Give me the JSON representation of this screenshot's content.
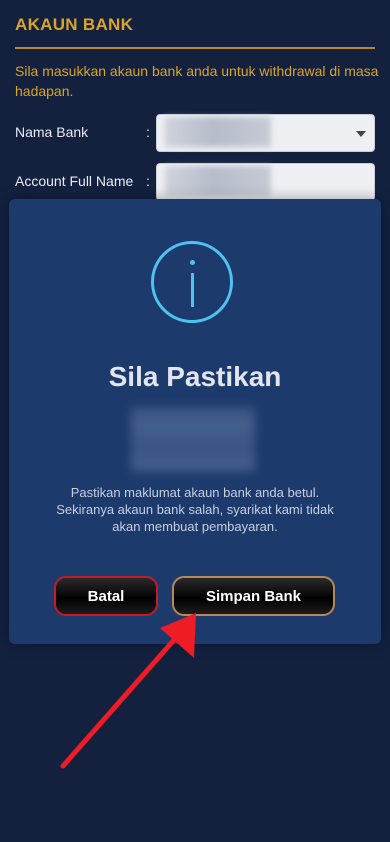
{
  "section": {
    "title": "AKAUN BANK",
    "description": "Sila masukkan akaun bank anda untuk withdrawal di masa hadapan."
  },
  "form": {
    "bank_name_label": "Nama Bank",
    "account_name_label": "Account Full Name",
    "colon": ":"
  },
  "modal": {
    "title": "Sila Pastikan",
    "message": "Pastikan maklumat akaun bank anda betul. Sekiranya akaun bank salah, syarikat kami tidak akan membuat pembayaran.",
    "cancel_label": "Batal",
    "save_label": "Simpan Bank"
  },
  "colors": {
    "background": "#13213f",
    "accent_gold": "#d8a52a",
    "modal_bg": "#1d3a6d",
    "info_icon": "#4ec3f2",
    "cancel_border": "#c61b24",
    "save_border": "#b8875a",
    "annotation_arrow": "#ee1c25"
  },
  "icons": {
    "dropdown": "caret-down-icon",
    "info": "info-icon",
    "annotation": "red-arrow-icon"
  }
}
